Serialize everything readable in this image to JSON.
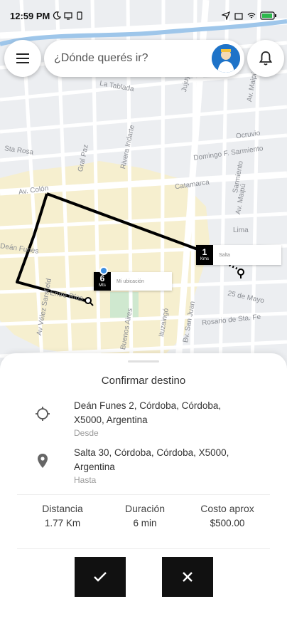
{
  "status_bar": {
    "time": "12:59 PM"
  },
  "search": {
    "placeholder": "¿Dónde querés ir?"
  },
  "map": {
    "street_labels": [
      "Gral Paz",
      "Rivera Indarte",
      "Catamarca",
      "Av. Colón",
      "Deán Funes",
      "25 de Mayo",
      "Entre Ríos",
      "Av Vélez Sarsfield",
      "Buenos Aires",
      "Ituzaingó",
      "Av. Maipú",
      "Lima",
      "Sarmiento",
      "Domingo F. Sarmiento",
      "Ocruvio",
      "Sta Rosa",
      "La Tablada",
      "Jujuy",
      "Av. Maipú",
      "Rosario de Sta. Fe",
      "Bv. San Juan"
    ],
    "markers": {
      "origin": {
        "distance": "6",
        "unit": "Mts",
        "label": "Mi ubicación"
      },
      "destination": {
        "distance": "1",
        "unit": "Kms",
        "label": "Salta"
      }
    }
  },
  "sheet": {
    "title": "Confirmar destino",
    "origin": {
      "address": "Deán Funes 2, Córdoba, Córdoba, X5000, Argentina",
      "caption": "Desde"
    },
    "destination": {
      "address": "Salta 30, Córdoba, Córdoba, X5000, Argentina",
      "caption": "Hasta"
    },
    "stats": [
      {
        "label": "Distancia",
        "value": "1.77 Km"
      },
      {
        "label": "Duración",
        "value": "6 min"
      },
      {
        "label": "Costo aprox",
        "value": "$500.00"
      }
    ],
    "confirm_icon": "check-icon",
    "cancel_icon": "close-icon"
  },
  "colors": {
    "route": "#000000",
    "center_area": "#f6efcf",
    "buttons": "#111111",
    "avatar_bg": "#1e73c8"
  }
}
